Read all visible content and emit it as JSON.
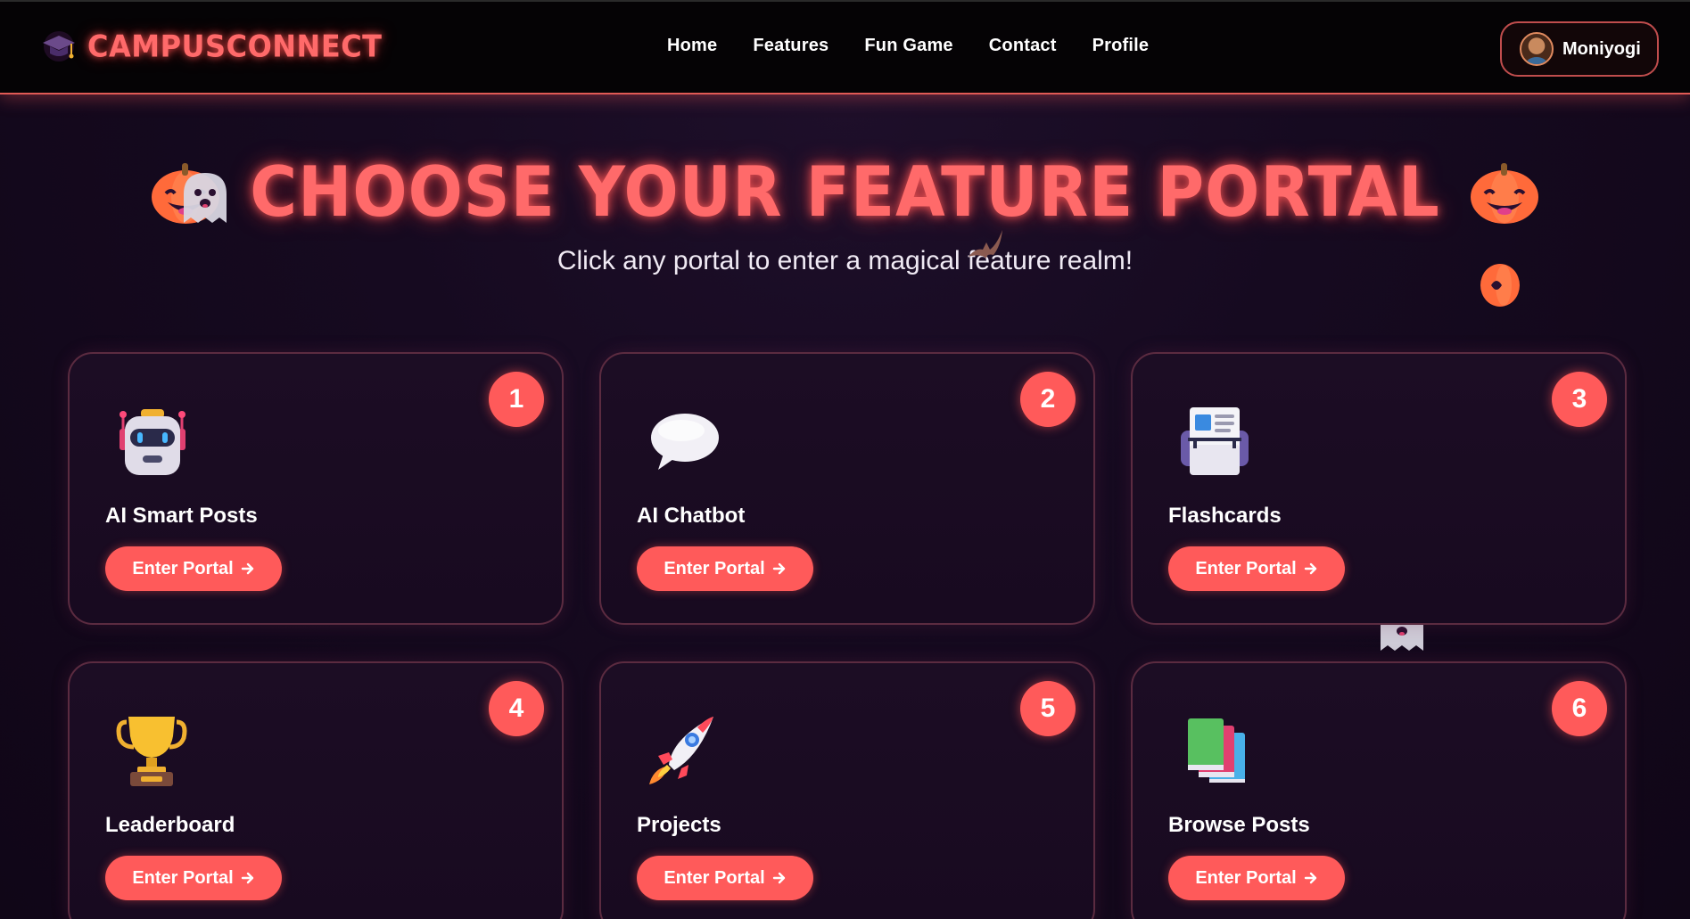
{
  "nav": {
    "brand": "CAMPUSCONNECT",
    "links": [
      "Home",
      "Features",
      "Fun Game",
      "Contact",
      "Profile"
    ],
    "user": "Moniyogi"
  },
  "hero": {
    "title": "CHOOSE YOUR FEATURE PORTAL",
    "subtitle": "Click any portal to enter a magical feature realm!"
  },
  "cards": [
    {
      "number": "1",
      "title": "AI Smart Posts",
      "button": "Enter Portal",
      "icon": "robot-icon"
    },
    {
      "number": "2",
      "title": "AI Chatbot",
      "button": "Enter Portal",
      "icon": "speech-bubble-icon"
    },
    {
      "number": "3",
      "title": "Flashcards",
      "button": "Enter Portal",
      "icon": "flashcard-printer-icon"
    },
    {
      "number": "4",
      "title": "Leaderboard",
      "button": "Enter Portal",
      "icon": "trophy-icon"
    },
    {
      "number": "5",
      "title": "Projects",
      "button": "Enter Portal",
      "icon": "rocket-icon"
    },
    {
      "number": "6",
      "title": "Browse Posts",
      "button": "Enter Portal",
      "icon": "books-icon"
    }
  ],
  "colors": {
    "accent": "#ff5a5a",
    "background": "#160a20",
    "nav_background": "#050305",
    "card_border": "#5b2b40"
  }
}
